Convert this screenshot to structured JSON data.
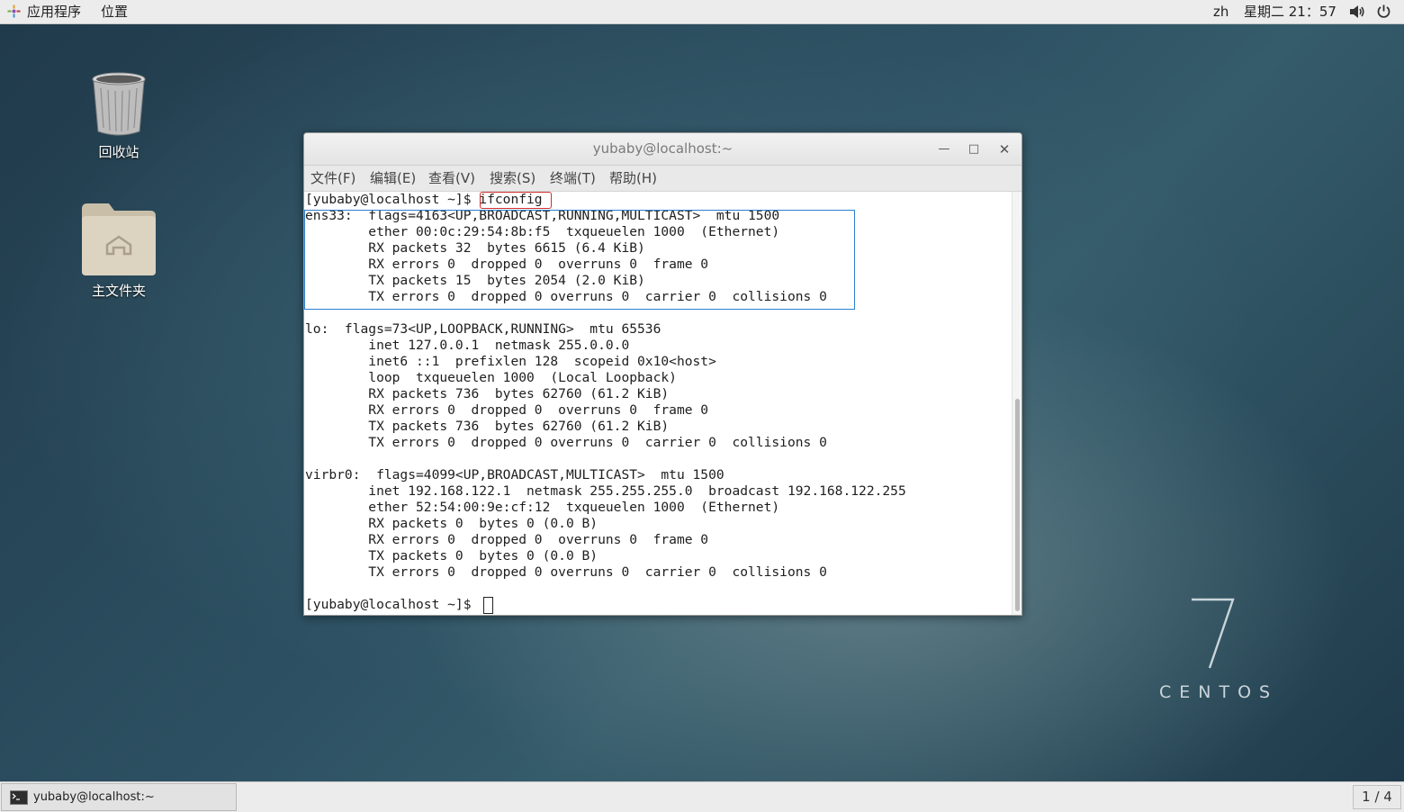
{
  "top_panel": {
    "applications": "应用程序",
    "places": "位置",
    "language": "zh",
    "datetime": "星期二 21：57"
  },
  "desktop": {
    "trash_label": "回收站",
    "home_label": "主文件夹"
  },
  "window": {
    "title": "yubaby@localhost:~",
    "menu": [
      "文件(F)",
      "编辑(E)",
      "查看(V)",
      "搜索(S)",
      "终端(T)",
      "帮助(H)"
    ],
    "prompt": "[yubaby@localhost ~]$ ",
    "command": "ifconfig",
    "lines": [
      "ens33:  flags=4163<UP,BROADCAST,RUNNING,MULTICAST>  mtu 1500",
      "        ether 00:0c:29:54:8b:f5  txqueuelen 1000  (Ethernet)",
      "        RX packets 32  bytes 6615 (6.4 KiB)",
      "        RX errors 0  dropped 0  overruns 0  frame 0",
      "        TX packets 15  bytes 2054 (2.0 KiB)",
      "        TX errors 0  dropped 0 overruns 0  carrier 0  collisions 0",
      "",
      "lo:  flags=73<UP,LOOPBACK,RUNNING>  mtu 65536",
      "        inet 127.0.0.1  netmask 255.0.0.0",
      "        inet6 ::1  prefixlen 128  scopeid 0x10<host>",
      "        loop  txqueuelen 1000  (Local Loopback)",
      "        RX packets 736  bytes 62760 (61.2 KiB)",
      "        RX errors 0  dropped 0  overruns 0  frame 0",
      "        TX packets 736  bytes 62760 (61.2 KiB)",
      "        TX errors 0  dropped 0 overruns 0  carrier 0  collisions 0",
      "",
      "virbr0:  flags=4099<UP,BROADCAST,MULTICAST>  mtu 1500",
      "        inet 192.168.122.1  netmask 255.255.255.0  broadcast 192.168.122.255",
      "        ether 52:54:00:9e:cf:12  txqueuelen 1000  (Ethernet)",
      "        RX packets 0  bytes 0 (0.0 B)",
      "        RX errors 0  dropped 0  overruns 0  frame 0",
      "        TX packets 0  bytes 0 (0.0 B)",
      "        TX errors 0  dropped 0 overruns 0  carrier 0  collisions 0",
      ""
    ],
    "final_prompt": "[yubaby@localhost ~]$ "
  },
  "taskbar": {
    "task_label": "yubaby@localhost:~",
    "workspace": "1 / 4"
  },
  "logo": {
    "text": "CENTOS"
  },
  "colors": {
    "command_highlight": "#d12d2d",
    "block_highlight": "#2b7fd1"
  }
}
